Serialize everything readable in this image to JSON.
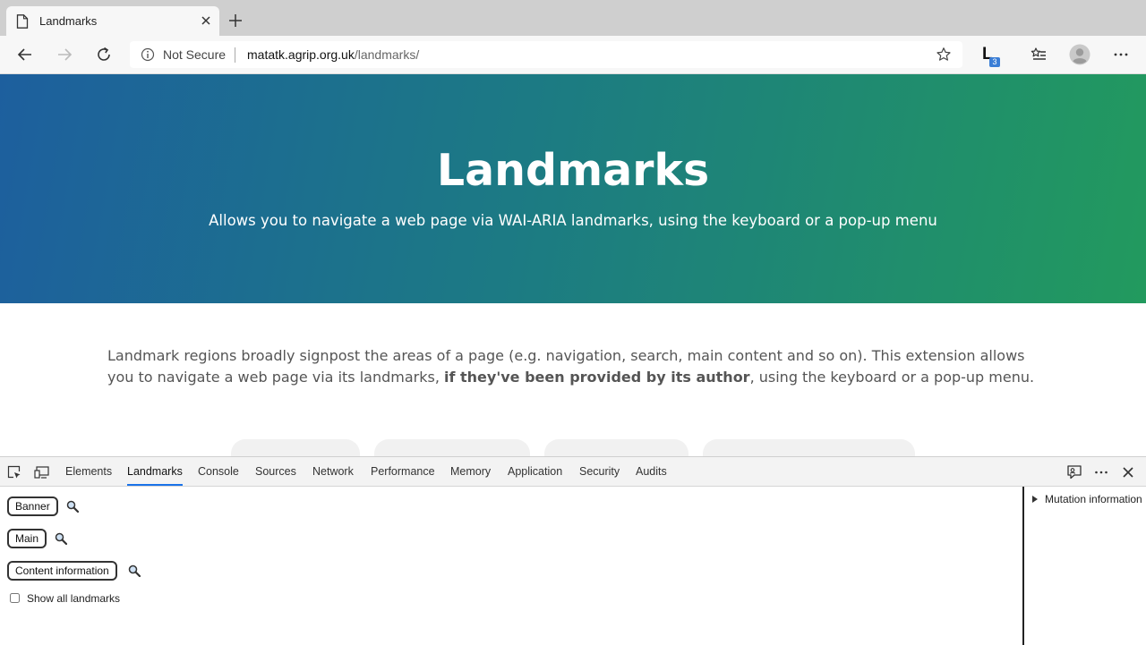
{
  "browser": {
    "tab_title": "Landmarks",
    "not_secure": "Not Secure",
    "url_host": "matatk.agrip.org.uk",
    "url_path": "/landmarks/",
    "extension_letter": "L",
    "extension_badge": "3"
  },
  "hero": {
    "title": "Landmarks",
    "subtitle": "Allows you to navigate a web page via WAI-ARIA landmarks, using the keyboard or a pop-up menu"
  },
  "intro": {
    "before": "Landmark regions broadly signpost the areas of a page (e.g. navigation, search, main content and so on). This extension allows you to navigate a web page via its landmarks, ",
    "bold": "if they've been provided by its author",
    "after": ", using the keyboard or a pop-up menu."
  },
  "devtools": {
    "tabs": [
      "Elements",
      "Landmarks",
      "Console",
      "Sources",
      "Network",
      "Performance",
      "Memory",
      "Application",
      "Security",
      "Audits"
    ],
    "active_tab": "Landmarks",
    "landmarks": [
      "Banner",
      "Main",
      "Content information"
    ],
    "show_all_label": "Show all landmarks",
    "mutation_label": "Mutation information"
  },
  "colors": {
    "hero_start": "#1d5f9e",
    "hero_end": "#229a5e",
    "active_tab_underline": "#1a73e8",
    "extension_badge": "#3b7ed6"
  },
  "icons": [
    "page-icon",
    "close-icon",
    "plus-icon",
    "back-arrow-icon",
    "forward-arrow-icon",
    "refresh-icon",
    "info-icon",
    "star-icon",
    "favorites-icon",
    "avatar-icon",
    "more-icon",
    "inspect-icon",
    "device-icon",
    "feedback-icon",
    "search-icon",
    "triangle-right-icon"
  ]
}
